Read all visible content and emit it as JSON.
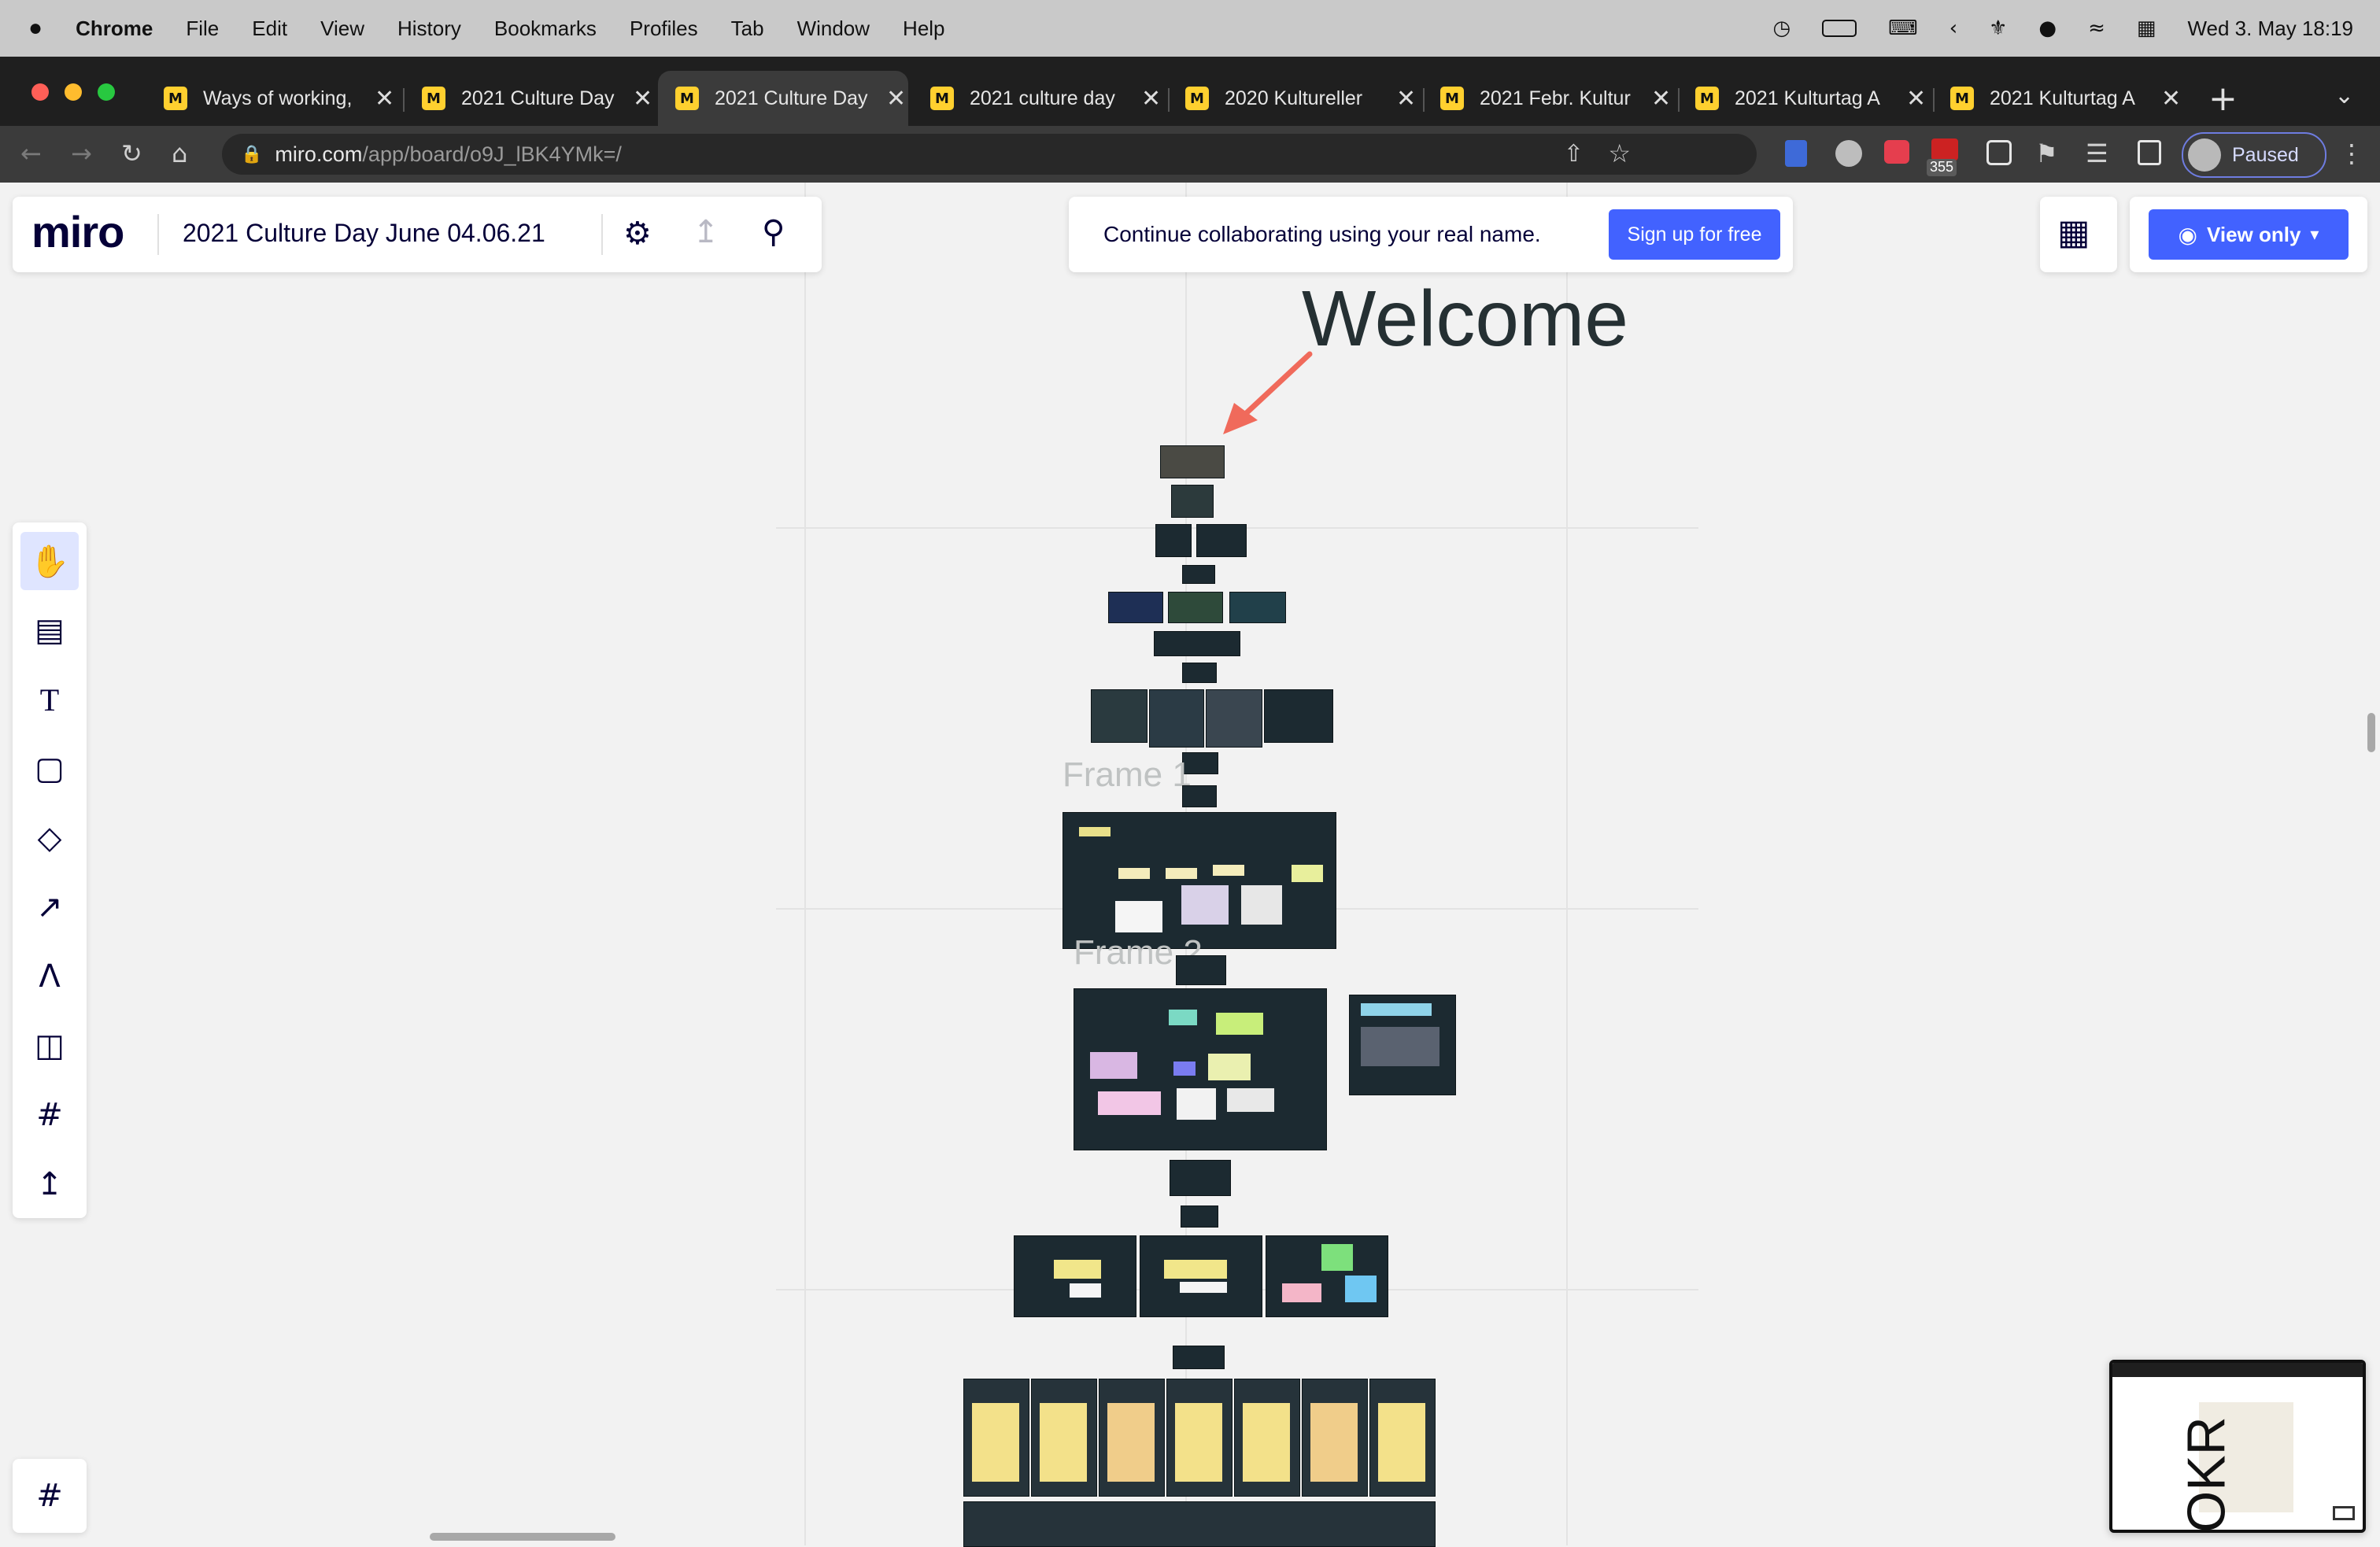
{
  "menubar": {
    "apple": "",
    "items": [
      "Chrome",
      "File",
      "Edit",
      "View",
      "History",
      "Bookmarks",
      "Profiles",
      "Tab",
      "Window",
      "Help"
    ],
    "datetime": "Wed 3. May  18:19"
  },
  "tabs": [
    {
      "title": "Ways of working,"
    },
    {
      "title": "2021 Culture Day"
    },
    {
      "title": "2021 Culture Day"
    },
    {
      "title": "2021 culture day"
    },
    {
      "title": "2020 Kultureller"
    },
    {
      "title": "2021 Febr. Kultur"
    },
    {
      "title": "2021 Kulturtag A"
    },
    {
      "title": "2021 Kulturtag A"
    }
  ],
  "address": {
    "host": "miro.com",
    "path": "/app/board/o9J_lBK4YMk=/"
  },
  "profile": {
    "label": "Paused",
    "badge": "355"
  },
  "miro": {
    "logo": "miro",
    "board_title": "2021 Culture Day June 04.06.21",
    "collab_text": "Continue collaborating using your real name.",
    "signup_label": "Sign up for free",
    "view_only_label": "View only"
  },
  "board": {
    "welcome": "Welcome",
    "frame1": "Frame 1",
    "frame2": "Frame 2",
    "minimap_label": "OKR"
  },
  "colors": {
    "accent": "#4262ff",
    "tab_favicon": "#ffd02f",
    "arrow": "#f06a5b"
  }
}
